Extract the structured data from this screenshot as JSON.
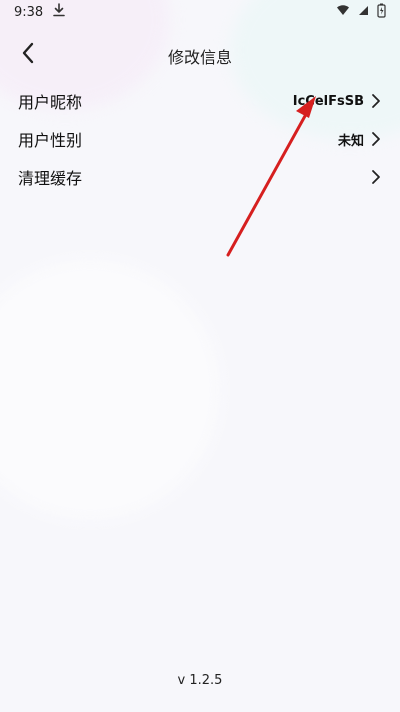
{
  "status_bar": {
    "time": "9:38",
    "download_icon": "download-icon",
    "wifi_icon": "wifi-icon",
    "signal_icon": "signal-icon",
    "battery_icon": "battery-charging-icon"
  },
  "header": {
    "back_icon": "chevron-left-icon",
    "title": "修改信息"
  },
  "settings": [
    {
      "label": "用户昵称",
      "value": "IcCelFsSB"
    },
    {
      "label": "用户性别",
      "value": "未知"
    },
    {
      "label": "清理缓存",
      "value": ""
    }
  ],
  "footer": {
    "version": "v 1.2.5"
  },
  "colors": {
    "background": "#f7f7fb",
    "annotation_arrow": "#d61f1f",
    "text": "#111111"
  }
}
